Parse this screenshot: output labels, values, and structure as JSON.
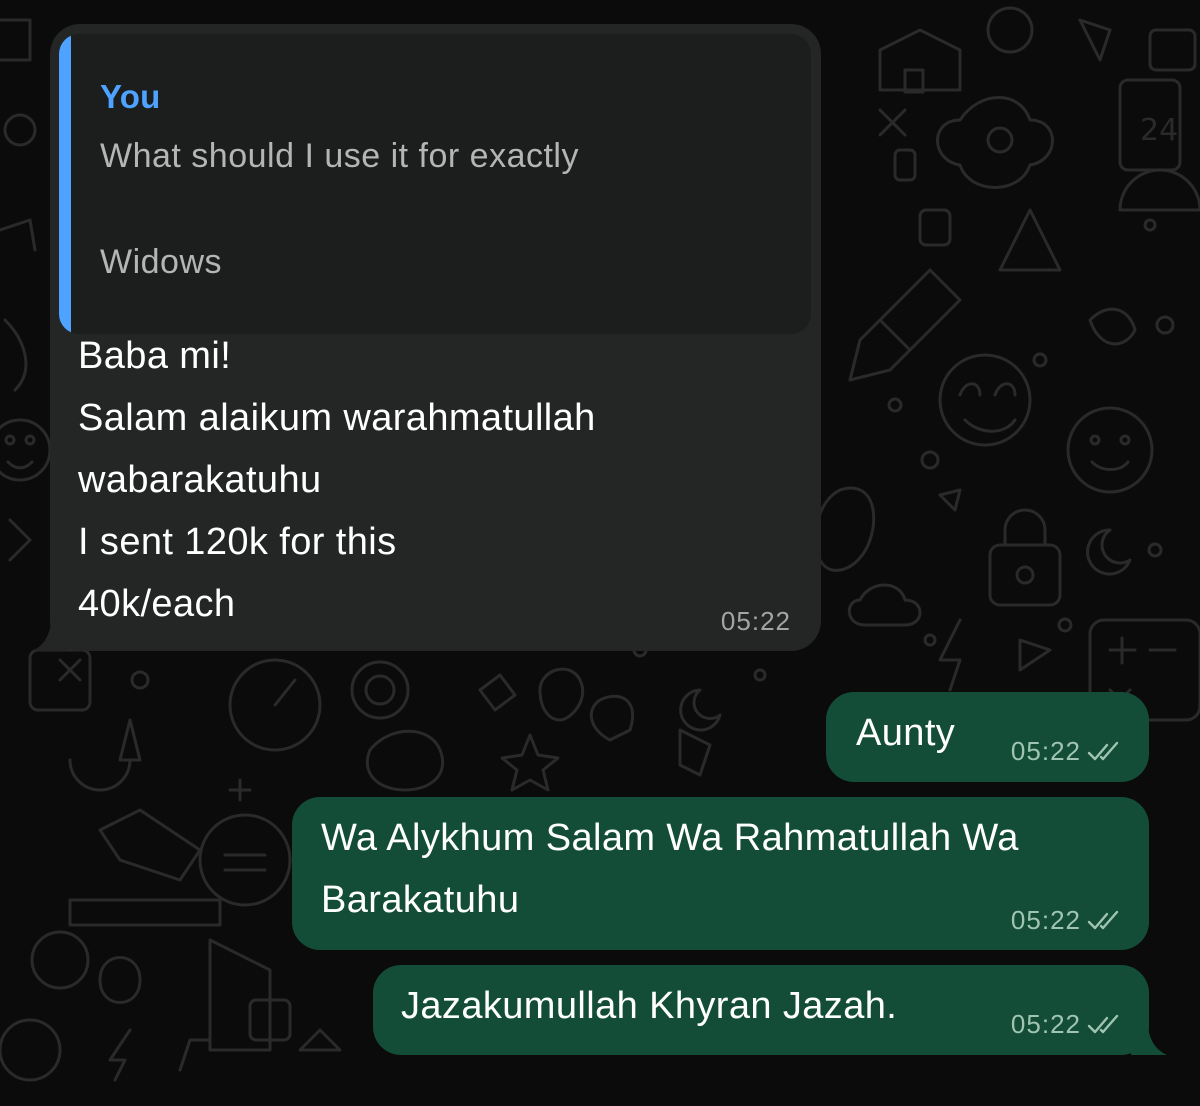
{
  "theme": {
    "incoming_bubble_color": "#242626",
    "outgoing_bubble_color": "#134d37",
    "quote_accent_color": "#4da3ff",
    "background_color": "#0b0b0b"
  },
  "incoming_message": {
    "quoted": {
      "author": "You",
      "line1": "What should I use it for exactly",
      "line2": "Widows"
    },
    "lines": [
      "Baba mi!",
      "Salam alaikum warahmatullah",
      "wabarakatuhu",
      "I sent 120k for this",
      "40k/each"
    ],
    "time": "05:22"
  },
  "outgoing_messages": [
    {
      "lines": [
        "Aunty"
      ],
      "time": "05:22",
      "status_icon": "double-check-icon"
    },
    {
      "lines": [
        "Wa Alykhum Salam Wa Rahmatullah Wa",
        "Barakatuhu"
      ],
      "time": "05:22",
      "status_icon": "double-check-icon"
    },
    {
      "lines": [
        "Jazakumullah Khyran Jazah."
      ],
      "time": "05:22",
      "status_icon": "double-check-icon"
    }
  ]
}
